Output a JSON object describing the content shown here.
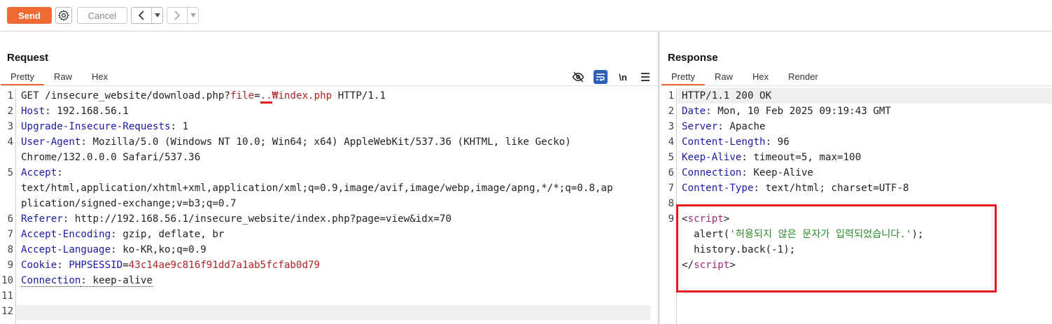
{
  "toolbar": {
    "send_label": "Send",
    "cancel_label": "Cancel"
  },
  "request": {
    "title": "Request",
    "tabs": [
      "Pretty",
      "Raw",
      "Hex"
    ],
    "icons": [
      "eye-off-icon",
      "wrap-icon",
      "newline-icon",
      "menu-icon"
    ],
    "newline_label": "\\n",
    "lines": {
      "l1_method": "GET /insecure_website/download.php?",
      "l1_param": "file",
      "l1_eq": "=",
      "l1_dots": "..",
      "l1_path": "₩index.php",
      "l1_proto": " HTTP/1.1",
      "l2_key": "Host",
      "l2_val": ": 192.168.56.1",
      "l3_key": "Upgrade-Insecure-Requests",
      "l3_val": ": 1",
      "l4_key": "User-Agent",
      "l4_val": ": Mozilla/5.0 (Windows NT 10.0; Win64; x64) AppleWebKit/537.36 (KHTML, like Gecko)",
      "l4_cont": "Chrome/132.0.0.0 Safari/537.36",
      "l5_key": "Accept",
      "l5_val": ":",
      "l5_cont1": "text/html,application/xhtml+xml,application/xml;q=0.9,image/avif,image/webp,image/apng,*/*;q=0.8,ap",
      "l5_cont2": "plication/signed-exchange;v=b3;q=0.7",
      "l6_key": "Referer",
      "l6_val": ": http://192.168.56.1/insecure_website/index.php?page=view&idx=70",
      "l7_key": "Accept-Encoding",
      "l7_val": ": gzip, deflate, br",
      "l8_key": "Accept-Language",
      "l8_val": ": ko-KR,ko;q=0.9",
      "l9_key": "Cookie",
      "l9_sep": ": ",
      "l9_ckey": "PHPSESSID",
      "l9_eq": "=",
      "l9_cval": "43c14ae9c816f91dd7a1ab5fcfab0d79",
      "l10_key": "Connection",
      "l10_val": ": keep-alive"
    },
    "line_numbers": [
      "1",
      "2",
      "3",
      "4",
      "5",
      "6",
      "7",
      "8",
      "9",
      "10",
      "11",
      "12"
    ]
  },
  "response": {
    "title": "Response",
    "tabs": [
      "Pretty",
      "Raw",
      "Hex",
      "Render"
    ],
    "lines": {
      "l1": "HTTP/1.1 200 OK",
      "l2_key": "Date",
      "l2_val": ": Mon, 10 Feb 2025 09:19:43 GMT",
      "l3_key": "Server",
      "l3_val": ": Apache",
      "l4_key": "Content-Length",
      "l4_val": ": 96",
      "l5_key": "Keep-Alive",
      "l5_val": ": timeout=5, max=100",
      "l6_key": "Connection",
      "l6_val": ": Keep-Alive",
      "l7_key": "Content-Type",
      "l7_val": ": text/html; charset=UTF-8",
      "l9_open_lt": "<",
      "l9_open_tag": "script",
      "l9_open_gt": ">",
      "l10_pre": "  alert(",
      "l10_str": "'허용되지 않은 문자가 입력되었습니다.'",
      "l10_post": ");",
      "l11": "  history.back(-1);",
      "l12_open": "</",
      "l12_tag": "script",
      "l12_gt": ">"
    },
    "line_numbers": [
      "1",
      "2",
      "3",
      "4",
      "5",
      "6",
      "7",
      "8",
      "9"
    ]
  }
}
